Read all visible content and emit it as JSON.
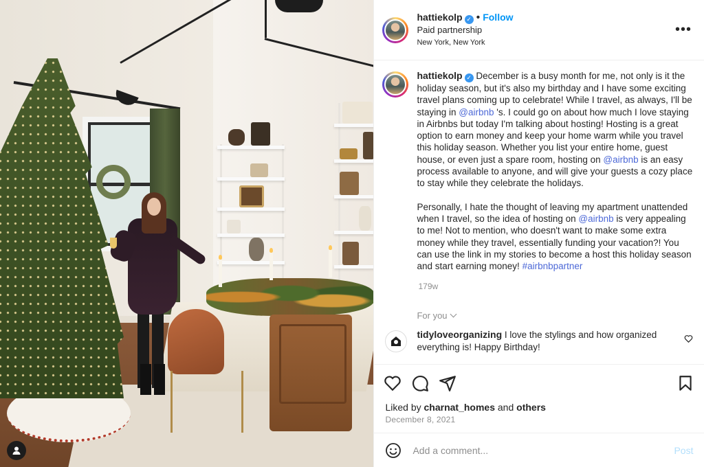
{
  "photo": {
    "alt": ""
  },
  "header": {
    "username": "hattiekolp",
    "separator": "•",
    "follow_label": "Follow",
    "subtitle": "Paid partnership",
    "location": "New York, New York",
    "more_label": "•••"
  },
  "caption": {
    "username": "hattiekolp",
    "p1_part1": "December is a busy month for me, not only is it the holiday season, but it's also my birthday and I have some exciting travel plans coming up to celebrate! While I travel, as always, I'll be staying in ",
    "p1_mention1": "@airbnb",
    "p1_part2": " 's. I could go on about how much I love staying in Airbnbs but today I'm talking about hosting! Hosting is a great option to earn money and keep your home warm while you travel this holiday season. Whether you list your entire home, guest house, or even just a spare room, hosting on ",
    "p1_mention2": "@airbnb",
    "p1_part3": " is an easy process available to anyone, and will give your guests a cozy place to stay while they celebrate the holidays.",
    "p2_part1": "Personally, I hate the thought of leaving my apartment unattended when I travel, so the idea of hosting on ",
    "p2_mention1": "@airbnb",
    "p2_part2": " is very appealing to me! Not to mention, who doesn't want to make some extra money while they travel, essentially funding your vacation?! You can use the link in my stories to become a host this holiday season and start earning money! ",
    "p2_hashtag": "#airbnbpartner",
    "age": "179w"
  },
  "for_you_label": "For you",
  "comments": [
    {
      "username": "tidyloveorganizing",
      "text": " I love the stylings and how organized everything is! Happy Birthday!"
    }
  ],
  "likes": {
    "prefix": "Liked by ",
    "user": "charnat_homes",
    "middle": " and ",
    "others": "others"
  },
  "date": "December 8, 2021",
  "add_comment": {
    "placeholder": "Add a comment...",
    "post_label": "Post"
  },
  "colors": {
    "link": "#0095f6",
    "mention": "#4c68d7",
    "muted": "#8e8e8e",
    "post_disabled": "#b2dffc"
  }
}
